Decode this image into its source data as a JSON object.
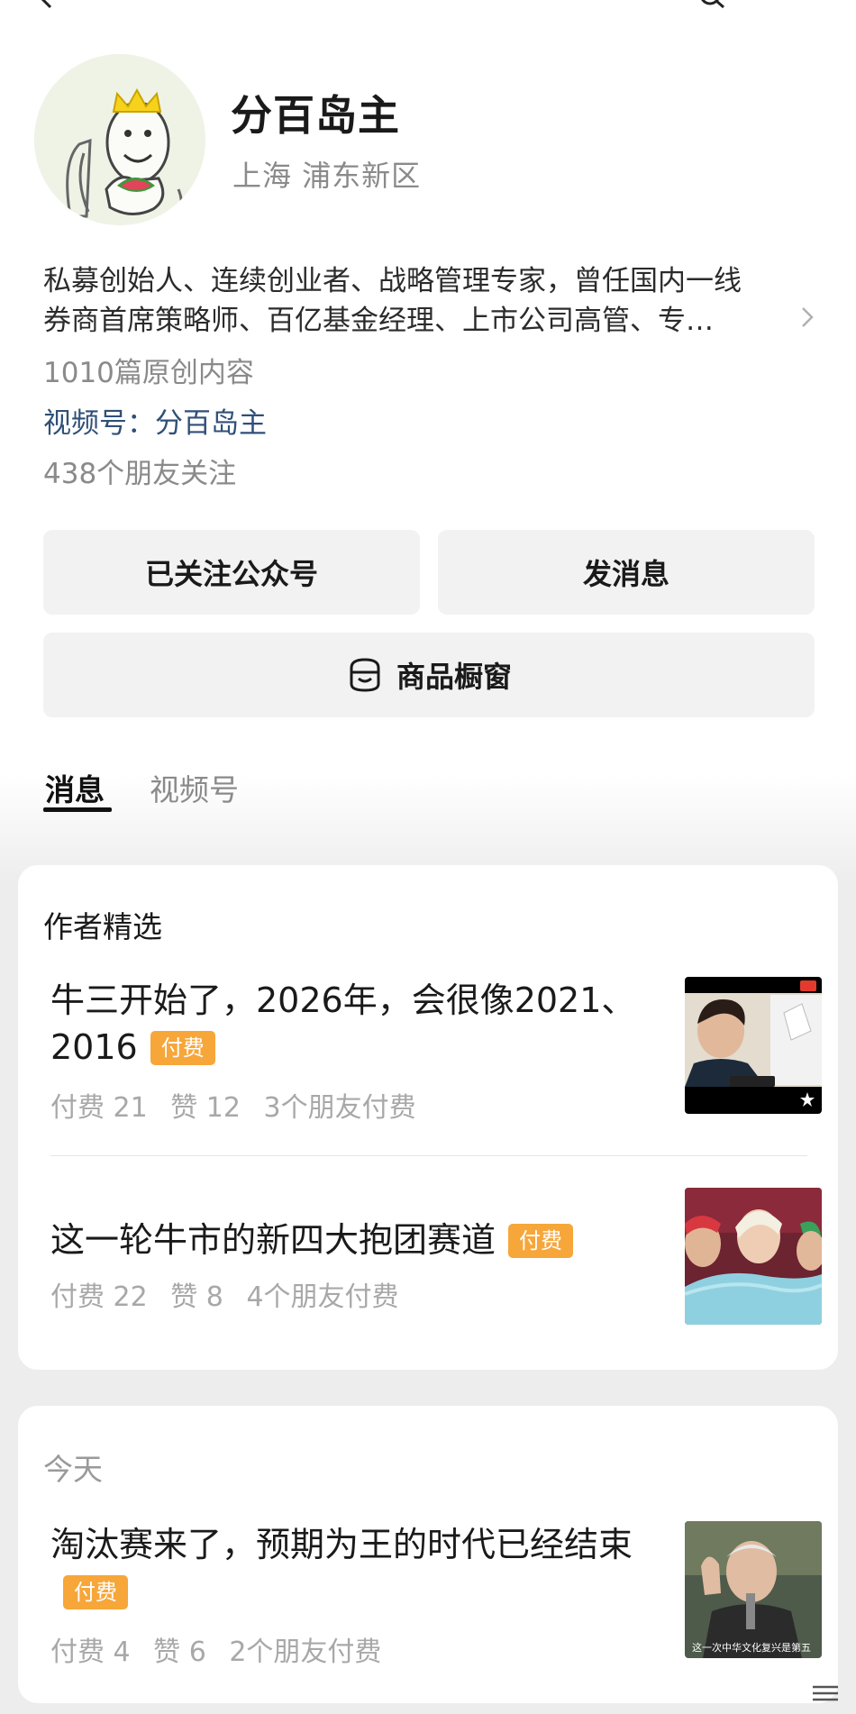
{
  "profile": {
    "name": "分百岛主",
    "location": "上海 浦东新区",
    "bio_line1": "私募创始人、连续创业者、战略管理专家，曾任国内一线",
    "bio_line2": "券商首席策略师、百亿基金经理、上市公司高管、专…",
    "articles_count": "1010篇原创内容",
    "channel_label": "视频号：",
    "channel_name": "分百岛主",
    "friends_follow": "438个朋友关注"
  },
  "actions": {
    "follow_label": "已关注公众号",
    "message_label": "发消息",
    "shop_label": "商品橱窗"
  },
  "tabs": [
    {
      "label": "消息",
      "active": true
    },
    {
      "label": "视频号",
      "active": false
    }
  ],
  "featured": {
    "title": "作者精选",
    "articles": [
      {
        "title": "牛三开始了，2026年，会很像2021、2016",
        "badge": "付费",
        "paid": "付费 21",
        "likes": "赞 12",
        "friends": "3个朋友付费"
      },
      {
        "title": "这一轮牛市的新四大抱团赛道",
        "badge": "付费",
        "paid": "付费 22",
        "likes": "赞 8",
        "friends": "4个朋友付费"
      }
    ]
  },
  "today": {
    "title": "今天",
    "articles": [
      {
        "title": "淘汰赛来了，预期为王的时代已经结束",
        "badge": "付费",
        "paid": "付费 4",
        "likes": "赞 6",
        "friends": "2个朋友付费",
        "thumb_caption": "这一次中华文化复兴是第五"
      }
    ]
  },
  "colors": {
    "badge": "#f7a63a",
    "link": "#2f4f77",
    "muted": "#8a8a8a",
    "button_bg": "#f2f2f2"
  }
}
